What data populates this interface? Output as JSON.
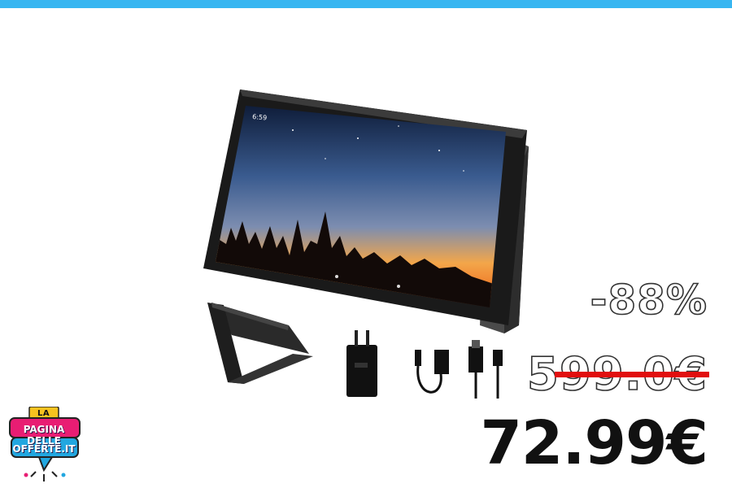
{
  "colors": {
    "accent": "#38b6f1",
    "strike": "#e10e0e",
    "logo_pink": "#e81d73",
    "logo_blue": "#22a7e0"
  },
  "tablet": {
    "clock": "6:59"
  },
  "pricing": {
    "discount": "-88%",
    "old_price": "599.0€",
    "new_price": "72.99€"
  },
  "logo": {
    "small": "LA",
    "line1": "PAGINA DELLE",
    "line2": "OFFERTE.IT"
  },
  "icons": [
    "tablet-image",
    "case-image",
    "charger-image",
    "otg-cable-image",
    "usb-cable-image",
    "logo-image"
  ]
}
